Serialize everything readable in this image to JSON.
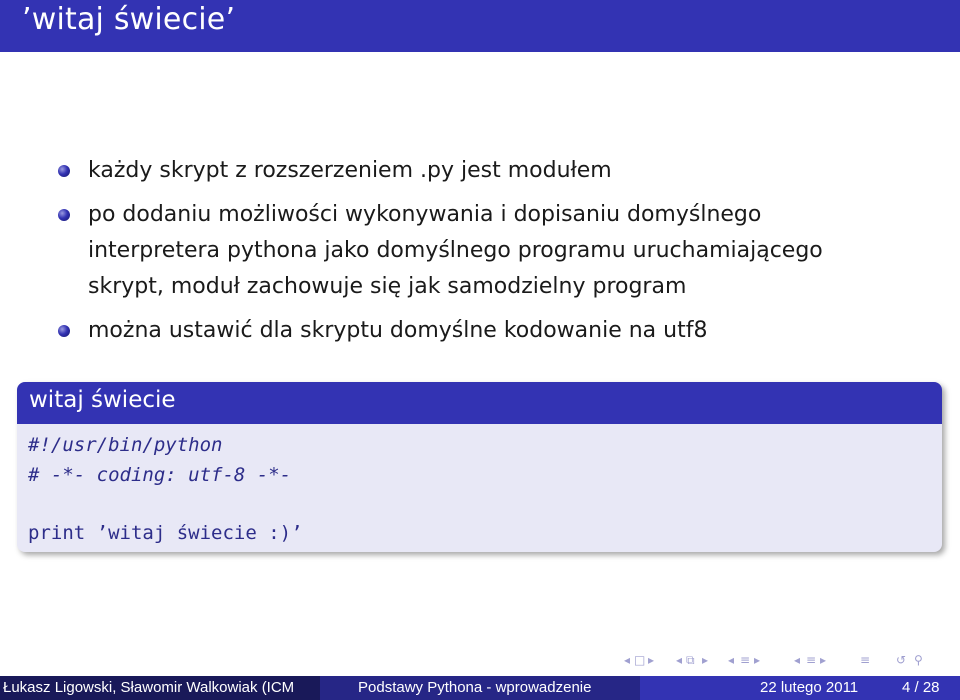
{
  "slide": {
    "title": "’witaj świecie’",
    "bullets": [
      [
        "każdy skrypt z rozszerzeniem .py jest modułem"
      ],
      [
        "po dodaniu możliwości wykonywania i dopisaniu domyślnego",
        "interpretera pythona jako domyślnego programu uruchamiającego",
        "skrypt, moduł zachowuje się jak samodzielny program"
      ],
      [
        "można ustawić dla skryptu domyślne kodowanie na utf8"
      ]
    ],
    "block": {
      "title": "witaj świecie",
      "code": [
        "#!/usr/bin/python",
        "# -*- coding: utf-8 -*-",
        "",
        "print ’witaj świecie :)’"
      ]
    }
  },
  "navigation": {
    "icons": [
      "nav-prev-frame-icon",
      "nav-frame-icon",
      "nav-next-frame-icon",
      "nav-prev-subsection-icon",
      "nav-subsection-icon",
      "nav-next-subsection-icon",
      "nav-prev-section-icon",
      "nav-section-icon",
      "nav-next-section-icon",
      "nav-align-icon",
      "nav-back-icon",
      "nav-search-icon"
    ]
  },
  "footer": {
    "authors": "Łukasz Ligowski, Sławomir Walkowiak (ICM",
    "talk_title": "Podstawy Pythona - wprowadzenie",
    "date": "22 lutego 2011",
    "page": "4 / 28"
  },
  "colors": {
    "title_bar": "#3333b3",
    "block_body": "#e8e8f6",
    "footer_left": "#191959",
    "footer_mid": "#262686",
    "footer_right": "#3333b3",
    "code_text": "#2d2d8a"
  }
}
